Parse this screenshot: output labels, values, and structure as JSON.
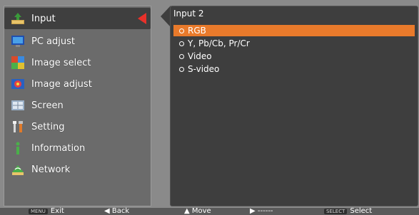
{
  "sidebar": {
    "items": [
      {
        "label": "Input",
        "icon": "input-arrow-icon",
        "selected": true
      },
      {
        "label": "PC adjust",
        "icon": "monitor-icon"
      },
      {
        "label": "Image select",
        "icon": "image-select-icon"
      },
      {
        "label": "Image adjust",
        "icon": "image-adjust-icon"
      },
      {
        "label": "Screen",
        "icon": "screen-icon"
      },
      {
        "label": "Setting",
        "icon": "setting-tools-icon"
      },
      {
        "label": "Information",
        "icon": "information-icon"
      },
      {
        "label": "Network",
        "icon": "network-icon"
      }
    ]
  },
  "panel": {
    "title": "Input 2",
    "options": [
      {
        "label": "RGB",
        "active": true
      },
      {
        "label": "Y, Pb/Cb, Pr/Cr",
        "active": false
      },
      {
        "label": "Video",
        "active": false
      },
      {
        "label": "S-video",
        "active": false
      }
    ]
  },
  "footer": {
    "exit_key": "MENU",
    "exit_label": "Exit",
    "back_label": "Back",
    "move_label": "Move",
    "next_label": "------",
    "select_key": "SELECT",
    "select_label": "Select"
  },
  "colors": {
    "highlight": "#e97a2b",
    "arrow": "#e8312a",
    "panel_bg": "#3e3e3e",
    "sidebar_bg": "#6b6b6b"
  }
}
